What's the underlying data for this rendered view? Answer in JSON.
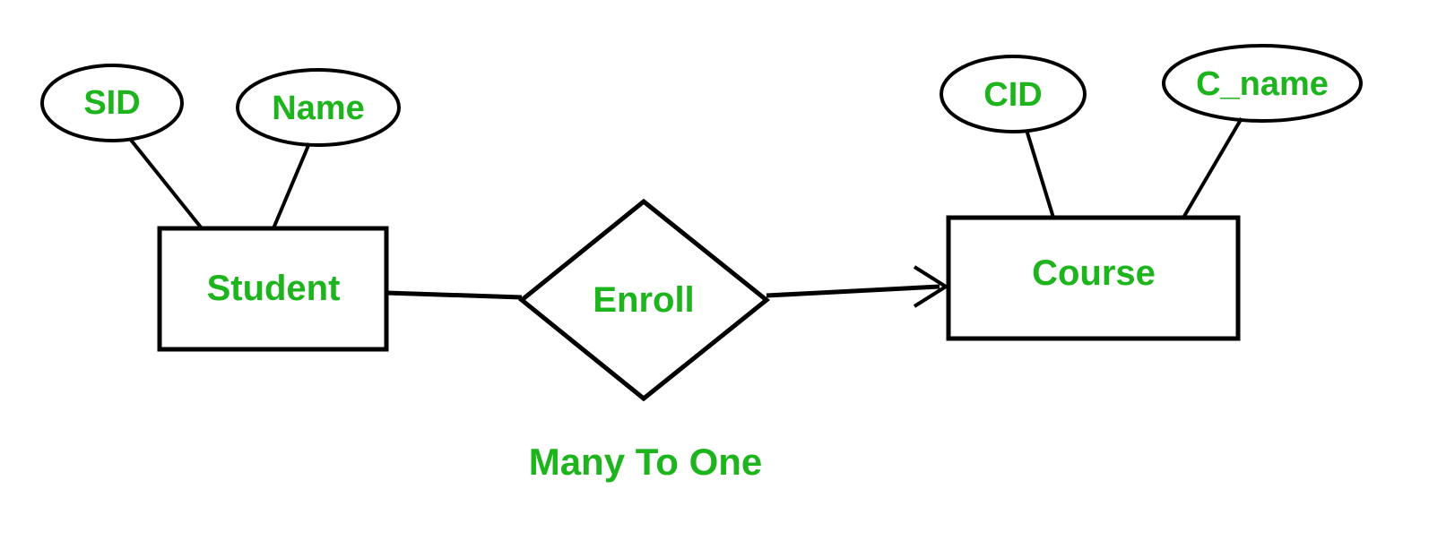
{
  "diagram": {
    "entities": {
      "student": {
        "label": "Student",
        "attributes": {
          "sid": "SID",
          "name": "Name"
        }
      },
      "course": {
        "label": "Course",
        "attributes": {
          "cid": "CID",
          "cname": "C_name"
        }
      }
    },
    "relationship": {
      "enroll": "Enroll"
    },
    "cardinality": "Many To One"
  }
}
